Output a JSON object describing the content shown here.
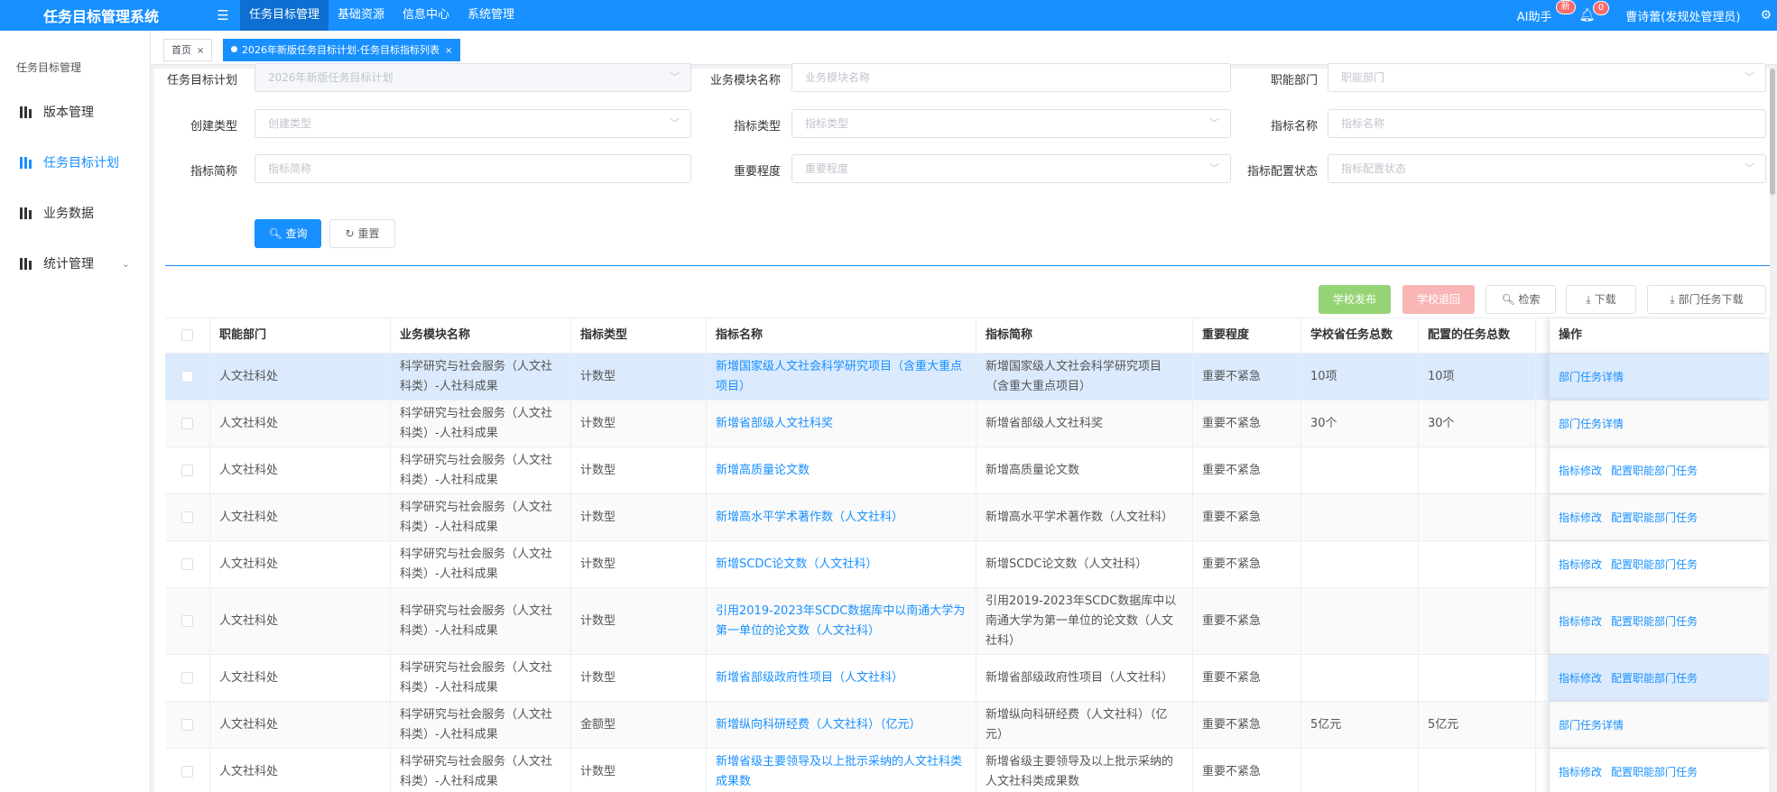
{
  "app": {
    "title": "任务目标管理系统"
  },
  "topnav": [
    "任务目标管理",
    "基础资源",
    "信息中心",
    "系统管理"
  ],
  "header": {
    "ai_label": "AI助手",
    "ai_badge": "新",
    "bell_badge": "0",
    "user": "曹诗蕾(发规处管理员)"
  },
  "sidebar": {
    "section_title": "任务目标管理",
    "items": [
      {
        "label": "版本管理"
      },
      {
        "label": "任务目标计划"
      },
      {
        "label": "业务数据"
      },
      {
        "label": "统计管理"
      }
    ]
  },
  "tabs": [
    {
      "label": "首页"
    },
    {
      "label": "2026年新版任务目标计划-任务目标指标列表"
    }
  ],
  "filters": {
    "plan": {
      "label": "任务目标计划",
      "value": "2026年新版任务目标计划"
    },
    "module": {
      "label": "业务模块名称",
      "placeholder": "业务模块名称"
    },
    "dept": {
      "label": "职能部门",
      "placeholder": "职能部门"
    },
    "create_type": {
      "label": "创建类型",
      "placeholder": "创建类型"
    },
    "indicator_type": {
      "label": "指标类型",
      "placeholder": "指标类型"
    },
    "indicator_name": {
      "label": "指标名称",
      "placeholder": "指标名称"
    },
    "short_name": {
      "label": "指标简称",
      "placeholder": "指标简称"
    },
    "importance": {
      "label": "重要程度",
      "placeholder": "重要程度"
    },
    "config_status": {
      "label": "指标配置状态",
      "placeholder": "指标配置状态"
    },
    "query_label": "查询",
    "reset_label": "重置"
  },
  "toolbar": {
    "publish": "学校发布",
    "return": "学校退回",
    "search": "检索",
    "download": "下载",
    "dept_download": "部门任务下载"
  },
  "table": {
    "columns": [
      "职能部门",
      "业务模块名称",
      "指标类型",
      "指标名称",
      "指标简称",
      "重要程度",
      "学校省任务总数",
      "配置的任务总数",
      "操作"
    ],
    "rows": [
      {
        "dept": "人文社科处",
        "module": "科学研究与社会服务（人文社科类）-人社科成果",
        "type": "计数型",
        "name": "新增国家级人文社会科学研究项目（含重大重点项目）",
        "short": "新增国家级人文社会科学研究项目（含重大重点项目）",
        "importance": "重要不紧急",
        "school": "10项",
        "config": "10项",
        "ops": [
          "部门任务详情"
        ]
      },
      {
        "dept": "人文社科处",
        "module": "科学研究与社会服务（人文社科类）-人社科成果",
        "type": "计数型",
        "name": "新增省部级人文社科奖",
        "short": "新增省部级人文社科奖",
        "importance": "重要不紧急",
        "school": "30个",
        "config": "30个",
        "ops": [
          "部门任务详情"
        ]
      },
      {
        "dept": "人文社科处",
        "module": "科学研究与社会服务（人文社科类）-人社科成果",
        "type": "计数型",
        "name": "新增高质量论文数",
        "short": "新增高质量论文数",
        "importance": "重要不紧急",
        "school": "",
        "config": "",
        "ops": [
          "指标修改",
          "配置职能部门任务"
        ]
      },
      {
        "dept": "人文社科处",
        "module": "科学研究与社会服务（人文社科类）-人社科成果",
        "type": "计数型",
        "name": "新增高水平学术著作数（人文社科）",
        "short": "新增高水平学术著作数（人文社科）",
        "importance": "重要不紧急",
        "school": "",
        "config": "",
        "ops": [
          "指标修改",
          "配置职能部门任务"
        ]
      },
      {
        "dept": "人文社科处",
        "module": "科学研究与社会服务（人文社科类）-人社科成果",
        "type": "计数型",
        "name": "新增SCDC论文数（人文社科）",
        "short": "新增SCDC论文数（人文社科）",
        "importance": "重要不紧急",
        "school": "",
        "config": "",
        "ops": [
          "指标修改",
          "配置职能部门任务"
        ]
      },
      {
        "dept": "人文社科处",
        "module": "科学研究与社会服务（人文社科类）-人社科成果",
        "type": "计数型",
        "name": "引用2019-2023年SCDC数据库中以南通大学为第一单位的论文数（人文社科）",
        "short": "引用2019-2023年SCDC数据库中以南通大学为第一单位的论文数（人文社科）",
        "importance": "重要不紧急",
        "school": "",
        "config": "",
        "ops": [
          "指标修改",
          "配置职能部门任务"
        ]
      },
      {
        "dept": "人文社科处",
        "module": "科学研究与社会服务（人文社科类）-人社科成果",
        "type": "计数型",
        "name": "新增省部级政府性项目（人文社科）",
        "short": "新增省部级政府性项目（人文社科）",
        "importance": "重要不紧急",
        "school": "",
        "config": "",
        "ops": [
          "指标修改",
          "配置职能部门任务"
        ]
      },
      {
        "dept": "人文社科处",
        "module": "科学研究与社会服务（人文社科类）-人社科成果",
        "type": "金额型",
        "name": "新增纵向科研经费（人文社科）（亿元）",
        "short": "新增纵向科研经费（人文社科）（亿元）",
        "importance": "重要不紧急",
        "school": "5亿元",
        "config": "5亿元",
        "ops": [
          "部门任务详情"
        ]
      },
      {
        "dept": "人文社科处",
        "module": "科学研究与社会服务（人文社科类）-人社科成果",
        "type": "计数型",
        "name": "新增省级主要领导及以上批示采纳的人文社科类成果数",
        "short": "新增省级主要领导及以上批示采纳的人文社科类成果数",
        "importance": "重要不紧急",
        "school": "",
        "config": "",
        "ops": [
          "指标修改",
          "配置职能部门任务"
        ]
      }
    ]
  }
}
